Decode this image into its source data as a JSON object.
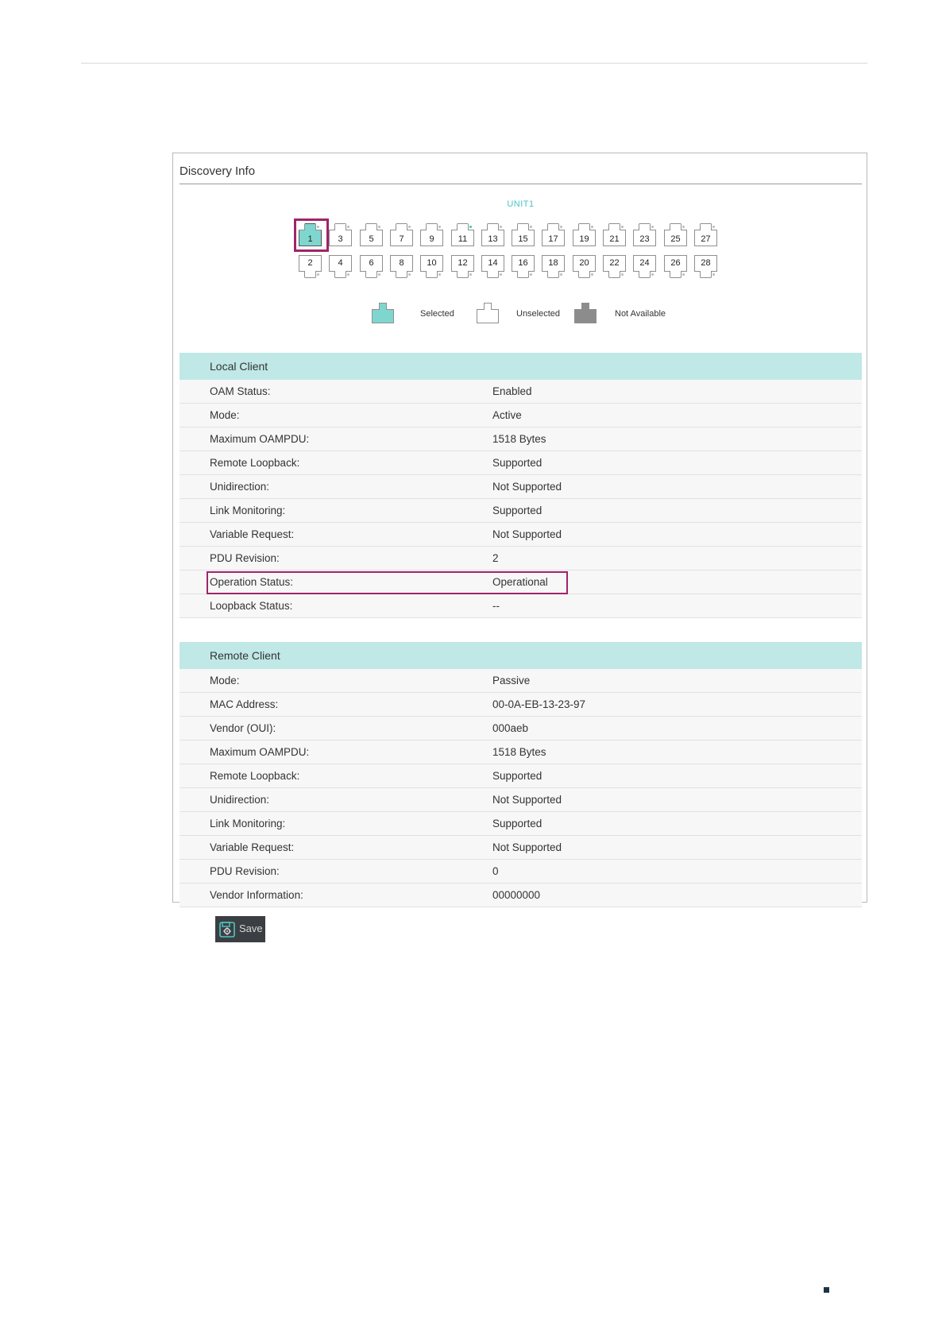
{
  "panel": {
    "title": "Discovery Info"
  },
  "unit": {
    "label": "UNIT1"
  },
  "ports": {
    "top": [
      {
        "num": "1",
        "state": "selected",
        "led": "off"
      },
      {
        "num": "3",
        "state": "unselected",
        "led": "off"
      },
      {
        "num": "5",
        "state": "unselected",
        "led": "off"
      },
      {
        "num": "7",
        "state": "unselected",
        "led": "off"
      },
      {
        "num": "9",
        "state": "unselected",
        "led": "off"
      },
      {
        "num": "11",
        "state": "unselected",
        "led": "on"
      },
      {
        "num": "13",
        "state": "unselected",
        "led": "off"
      },
      {
        "num": "15",
        "state": "unselected",
        "led": "off"
      },
      {
        "num": "17",
        "state": "unselected",
        "led": "off"
      },
      {
        "num": "19",
        "state": "unselected",
        "led": "off"
      },
      {
        "num": "21",
        "state": "unselected",
        "led": "off"
      },
      {
        "num": "23",
        "state": "unselected",
        "led": "off"
      },
      {
        "num": "25",
        "state": "unselected",
        "led": "off"
      },
      {
        "num": "27",
        "state": "unselected",
        "led": "off"
      }
    ],
    "bottom": [
      {
        "num": "2",
        "state": "unselected",
        "led": "off"
      },
      {
        "num": "4",
        "state": "unselected",
        "led": "off"
      },
      {
        "num": "6",
        "state": "unselected",
        "led": "off"
      },
      {
        "num": "8",
        "state": "unselected",
        "led": "off"
      },
      {
        "num": "10",
        "state": "unselected",
        "led": "off"
      },
      {
        "num": "12",
        "state": "unselected",
        "led": "off"
      },
      {
        "num": "14",
        "state": "unselected",
        "led": "off"
      },
      {
        "num": "16",
        "state": "unselected",
        "led": "off"
      },
      {
        "num": "18",
        "state": "unselected",
        "led": "off"
      },
      {
        "num": "20",
        "state": "unselected",
        "led": "off"
      },
      {
        "num": "22",
        "state": "unselected",
        "led": "off"
      },
      {
        "num": "24",
        "state": "unselected",
        "led": "off"
      },
      {
        "num": "26",
        "state": "unselected",
        "led": "off"
      },
      {
        "num": "28",
        "state": "unselected",
        "led": "off"
      }
    ]
  },
  "legend": {
    "selected": "Selected",
    "unselected": "Unselected",
    "not_available": "Not Available"
  },
  "local_client": {
    "title": "Local Client",
    "rows": [
      {
        "k": "OAM Status:",
        "v": "Enabled"
      },
      {
        "k": "Mode:",
        "v": "Active"
      },
      {
        "k": "Maximum OAMPDU:",
        "v": "1518 Bytes"
      },
      {
        "k": "Remote Loopback:",
        "v": "Supported"
      },
      {
        "k": "Unidirection:",
        "v": "Not Supported"
      },
      {
        "k": "Link Monitoring:",
        "v": "Supported"
      },
      {
        "k": "Variable Request:",
        "v": "Not Supported"
      },
      {
        "k": "PDU Revision:",
        "v": "2"
      },
      {
        "k": "Operation Status:",
        "v": "Operational"
      },
      {
        "k": "Loopback Status:",
        "v": "--"
      }
    ]
  },
  "remote_client": {
    "title": "Remote Client",
    "rows": [
      {
        "k": "Mode:",
        "v": "Passive"
      },
      {
        "k": "MAC Address:",
        "v": "00-0A-EB-13-23-97"
      },
      {
        "k": "Vendor (OUI):",
        "v": "000aeb"
      },
      {
        "k": "Maximum OAMPDU:",
        "v": "1518 Bytes"
      },
      {
        "k": "Remote Loopback:",
        "v": "Supported"
      },
      {
        "k": "Unidirection:",
        "v": "Not Supported"
      },
      {
        "k": "Link Monitoring:",
        "v": "Supported"
      },
      {
        "k": "Variable Request:",
        "v": "Not Supported"
      },
      {
        "k": "PDU Revision:",
        "v": "0"
      },
      {
        "k": "Vendor Information:",
        "v": "00000000"
      }
    ]
  },
  "toolbar": {
    "save_label": "Save",
    "save_icon": "save-gear-icon"
  },
  "colors": {
    "selected_port": "#7fd6cf",
    "section_header": "#bfe8e6",
    "highlight": "#a0246a",
    "not_available": "#8c8c8c"
  }
}
